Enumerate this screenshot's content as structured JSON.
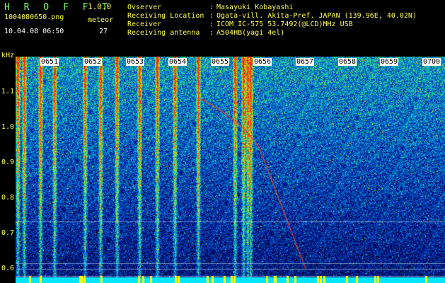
{
  "header": {
    "app_title": "H R O F F T",
    "app_version": "1.0.0",
    "file_name": "1004080650.png",
    "meteor_label": "meteor",
    "date_time": "10.04.08 06:50",
    "meteor_count": "27"
  },
  "info": [
    {
      "key": "Ovserver",
      "value": "Masayuki Kobayashi"
    },
    {
      "key": "Receiving Location",
      "value": "Ogata-vill. Akita-Pref. JAPAN (139.96E, 40.02N)"
    },
    {
      "key": "Receiver",
      "value": "ICOM IC-575 53.7492(@LCD)MHz USB"
    },
    {
      "key": "Receiving antenna",
      "value": "A504HB(yagi 4el)"
    }
  ],
  "axis": {
    "y_unit": "kHz",
    "y_ticks": [
      "1.1",
      "1.0",
      "0.9",
      "0.8",
      "0.7",
      "0.6"
    ],
    "x_ticks": [
      "0651",
      "0652",
      "0653",
      "0654",
      "0655",
      "0656",
      "0657",
      "0658",
      "0659",
      "0700"
    ]
  },
  "colors": {
    "background": "#000000",
    "header_text": "#7cfc66",
    "label_text": "#ffff4a"
  }
}
